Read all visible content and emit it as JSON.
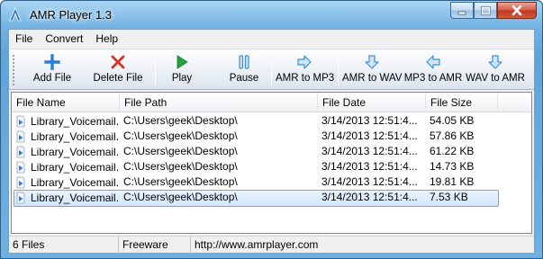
{
  "window": {
    "title": "AMR Player 1.3",
    "accent": "#5b9fd4"
  },
  "menu": {
    "items": [
      "File",
      "Convert",
      "Help"
    ]
  },
  "toolbar": {
    "buttons": [
      {
        "label": "Add File",
        "icon": "plus-icon",
        "color": "#2a7fd4"
      },
      {
        "label": "Delete File",
        "icon": "delete-x-icon",
        "color": "#d9312b"
      },
      {
        "label": "Play",
        "icon": "play-icon",
        "color": "#1ea63a"
      },
      {
        "label": "Pause",
        "icon": "pause-icon",
        "color": "#3f8fd8"
      },
      {
        "label": "AMR to MP3",
        "icon": "arrow-right-icon",
        "color": "#3f8fd8"
      },
      {
        "label": "AMR to WAV",
        "icon": "arrow-down-icon",
        "color": "#3f8fd8"
      },
      {
        "label": "MP3 to AMR",
        "icon": "arrow-left-icon",
        "color": "#3f8fd8"
      },
      {
        "label": "WAV to AMR",
        "icon": "arrow-down-icon",
        "color": "#3f8fd8"
      }
    ]
  },
  "list": {
    "columns": [
      "File Name",
      "File Path",
      "File Date",
      "File Size"
    ],
    "rows": [
      {
        "name": "Library_Voicemail...",
        "path": "C:\\Users\\geek\\Desktop\\",
        "date": "3/14/2013 12:51:4...",
        "size": "54.05 KB",
        "selected": false
      },
      {
        "name": "Library_Voicemail...",
        "path": "C:\\Users\\geek\\Desktop\\",
        "date": "3/14/2013 12:51:4...",
        "size": "57.86 KB",
        "selected": false
      },
      {
        "name": "Library_Voicemail...",
        "path": "C:\\Users\\geek\\Desktop\\",
        "date": "3/14/2013 12:51:4...",
        "size": "61.22 KB",
        "selected": false
      },
      {
        "name": "Library_Voicemail...",
        "path": "C:\\Users\\geek\\Desktop\\",
        "date": "3/14/2013 12:51:4...",
        "size": "14.73 KB",
        "selected": false
      },
      {
        "name": "Library_Voicemail...",
        "path": "C:\\Users\\geek\\Desktop\\",
        "date": "3/14/2013 12:51:4...",
        "size": "19.81 KB",
        "selected": false
      },
      {
        "name": "Library_Voicemail...",
        "path": "C:\\Users\\geek\\Desktop\\",
        "date": "3/14/2013 12:51:4...",
        "size": "7.53 KB",
        "selected": true
      }
    ]
  },
  "status": {
    "file_count": "6 Files",
    "license": "Freeware",
    "url": "http://www.amrplayer.com"
  }
}
